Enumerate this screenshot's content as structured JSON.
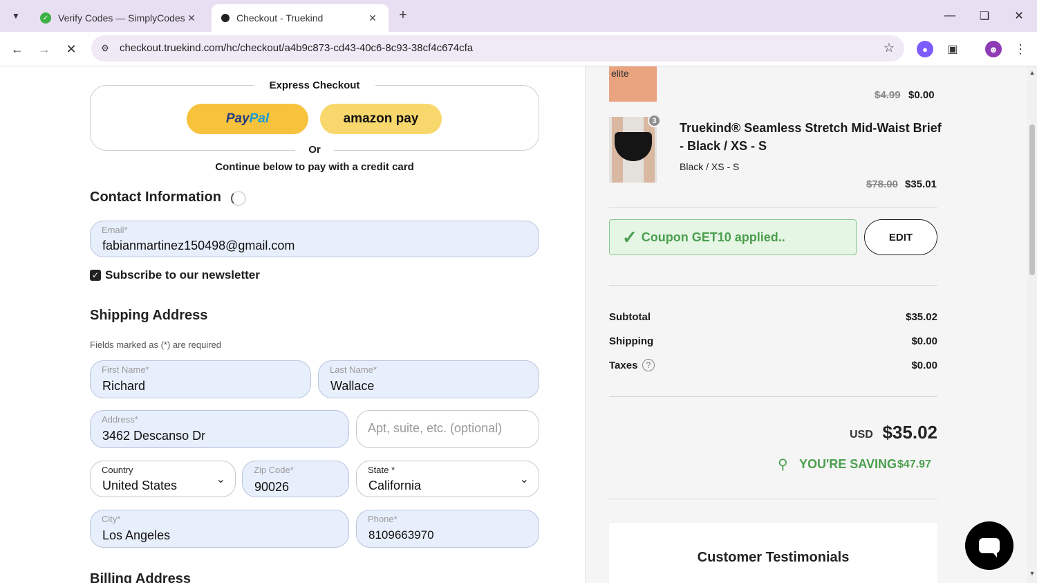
{
  "browser": {
    "tabs": [
      {
        "title": "Verify Codes — SimplyCodes",
        "active": false
      },
      {
        "title": "Checkout - Truekind",
        "active": true
      }
    ],
    "url": "checkout.truekind.com/hc/checkout/a4b9c873-cd43-40c6-8c93-38cf4c674cfa"
  },
  "checkout": {
    "express_title": "Express Checkout",
    "paypal_label_a": "Pay",
    "paypal_label_b": "Pal",
    "amazon_label": "amazon pay",
    "or_label": "Or",
    "continue_text": "Continue below to pay with a credit card",
    "contact_title": "Contact Information",
    "email_label": "Email*",
    "email_value": "fabianmartinez150498@gmail.com",
    "newsletter_label": "Subscribe to our newsletter",
    "newsletter_checked": true,
    "shipping_title": "Shipping Address",
    "required_note": "Fields marked as (*) are required",
    "first_name_label": "First Name*",
    "first_name_value": "Richard",
    "last_name_label": "Last Name*",
    "last_name_value": "Wallace",
    "address_label": "Address*",
    "address_value": "3462 Descanso Dr",
    "apt_placeholder": "Apt, suite, etc. (optional)",
    "country_label": "Country",
    "country_value": "United States",
    "zip_label": "Zip Code*",
    "zip_value": "90026",
    "state_label": "State *",
    "state_value": "California",
    "city_label": "City*",
    "city_value": "Los Angeles",
    "phone_label": "Phone*",
    "phone_value": "8109663970",
    "billing_title": "Billing Address"
  },
  "summary": {
    "item_top": {
      "thumb_text": "elite",
      "old_price": "$4.99",
      "price": "$0.00"
    },
    "item_brief": {
      "quantity": "3",
      "name": "Truekind® Seamless Stretch Mid-Waist Brief - Black / XS - S",
      "variant": "Black / XS - S",
      "old_price": "$78.00",
      "price": "$35.01"
    },
    "coupon_text": "Coupon GET10 applied..",
    "edit_label": "EDIT",
    "subtotal_label": "Subtotal",
    "subtotal_value": "$35.02",
    "shipping_label": "Shipping",
    "shipping_value": "$0.00",
    "taxes_label": "Taxes",
    "taxes_value": "$0.00",
    "total_currency": "USD",
    "total_value": "$35.02",
    "saving_label": "YOU'RE SAVING",
    "saving_value": "$47.97",
    "testimonials_title": "Customer Testimonials"
  },
  "colors": {
    "accent_green": "#4b9f4e",
    "field_bg": "#e8effc",
    "paypal_yellow": "#f7c23c"
  }
}
